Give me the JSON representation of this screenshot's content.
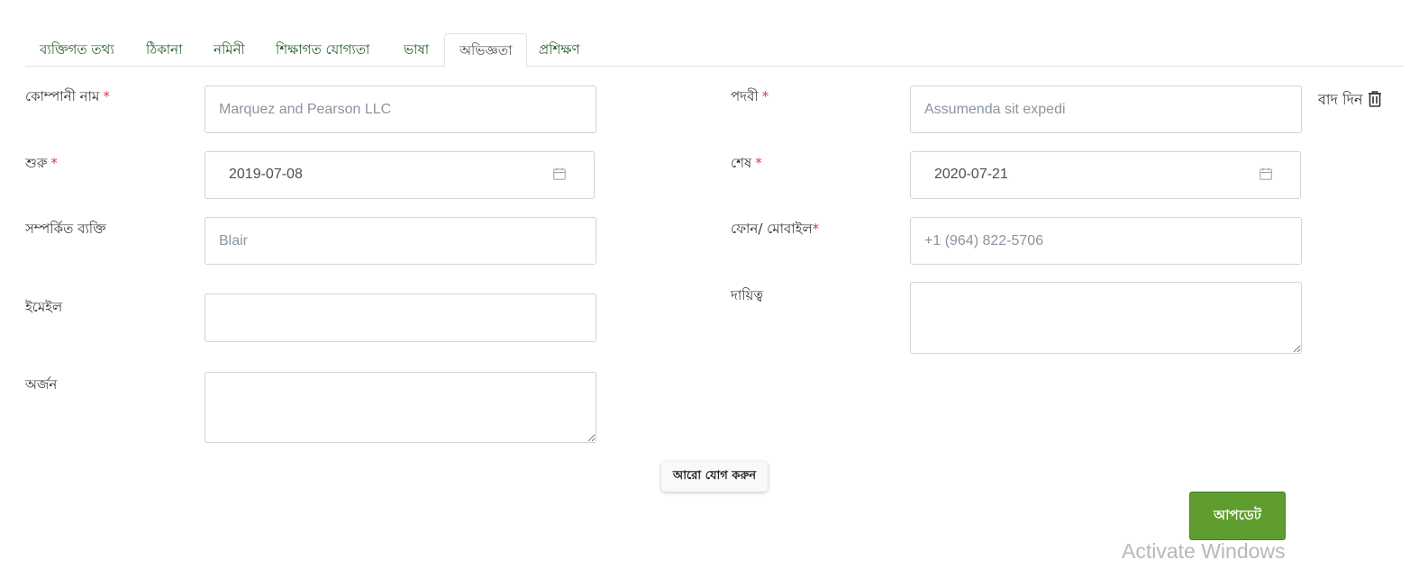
{
  "tabs": [
    {
      "label": "ব্যক্তিগত তথ্য",
      "active": false
    },
    {
      "label": "ঠিকানা",
      "active": false
    },
    {
      "label": "নমিনী",
      "active": false
    },
    {
      "label": "শিক্ষাগত যোগ্যতা",
      "active": false
    },
    {
      "label": "ভাষা",
      "active": false
    },
    {
      "label": "অভিজ্ঞতা",
      "active": true
    },
    {
      "label": "প্রশিক্ষণ",
      "active": false
    }
  ],
  "form": {
    "company": {
      "label": "কোম্পানী নাম",
      "required": "*",
      "placeholder": "Marquez and Pearson LLC"
    },
    "designation": {
      "label": "পদবী",
      "required": "*",
      "placeholder": "Assumenda sit expedi"
    },
    "start": {
      "label": "শুরু",
      "required": "*",
      "value": "2019-07-08"
    },
    "end": {
      "label": "শেষ",
      "required": "*",
      "value": "2020-07-21"
    },
    "contact_person": {
      "label": "সম্পর্কিত ব্যক্তি",
      "placeholder": "Blair"
    },
    "phone": {
      "label": "ফোন/ মোবাইল",
      "required": "*",
      "placeholder": "+1 (964) 822-5706"
    },
    "email": {
      "label": "ইমেইল",
      "value": ""
    },
    "responsibility": {
      "label": "দায়িত্ব",
      "value": ""
    },
    "achievement": {
      "label": "অর্জন",
      "value": ""
    }
  },
  "remove_label": "বাদ দিন",
  "icons": {
    "remove": "trash-icon",
    "date": "calendar-icon"
  },
  "buttons": {
    "add_more": "আরো যোগ করুন",
    "update": "আপডেট"
  },
  "watermark": "Activate Windows",
  "colors": {
    "tab_text": "#1f5c24",
    "required": "#dc3545",
    "update_button": "#5f9d2e"
  }
}
